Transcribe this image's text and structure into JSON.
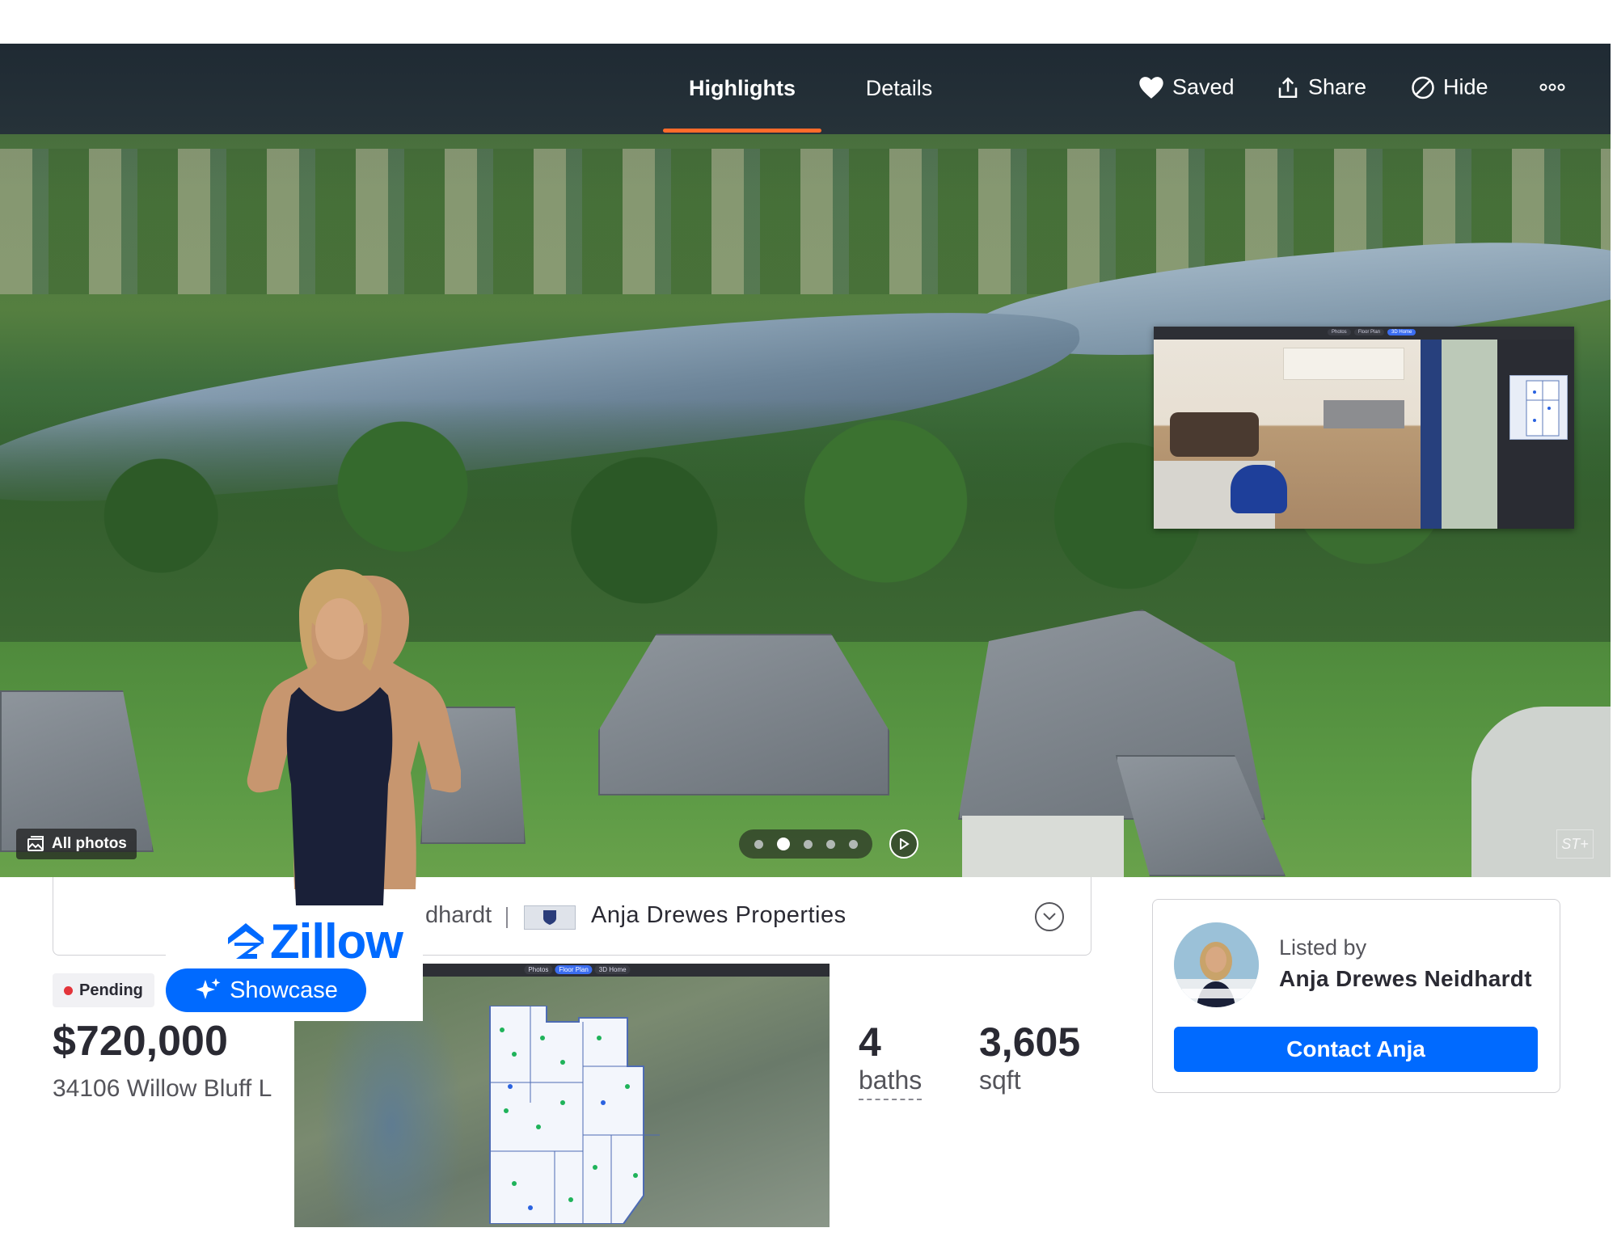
{
  "header": {
    "tabs": [
      {
        "label": "Highlights",
        "active": true
      },
      {
        "label": "Details",
        "active": false
      }
    ],
    "actions": {
      "saved": {
        "label": "Saved",
        "icon": "heart-icon"
      },
      "share": {
        "label": "Share",
        "icon": "share-icon"
      },
      "hide": {
        "label": "Hide",
        "icon": "hide-icon"
      },
      "more": {
        "icon": "more-icon"
      }
    }
  },
  "gallery": {
    "all_photos_label": "All photos",
    "photo_count_dots": 5,
    "active_dot": 2,
    "watermark": "ST+",
    "tour_tabs": [
      "Photos",
      "Floor Plan",
      "3D Home"
    ],
    "floorplan_tabs": [
      "Photos",
      "Floor Plan",
      "3D Home"
    ]
  },
  "branding": {
    "zillow_word": "Zillow",
    "showcase_label": "Showcase",
    "accent": "#006aff"
  },
  "agent_strip": {
    "name_tail": "dhardt",
    "brokerage": "Anja Drewes Properties"
  },
  "listing": {
    "status": "Pending",
    "status_color": "#e3343a",
    "price": "$720,000",
    "address": "34106 Willow Bluff L",
    "baths_value": "4",
    "baths_label": "baths",
    "sqft_value": "3,605",
    "sqft_label": "sqft"
  },
  "listing_card": {
    "listed_by_label": "Listed by",
    "agent_name": "Anja Drewes Neidhardt",
    "contact_label": "Contact Anja"
  },
  "colors": {
    "tab_underline": "#ff6b2b",
    "primary_button": "#006aff"
  }
}
